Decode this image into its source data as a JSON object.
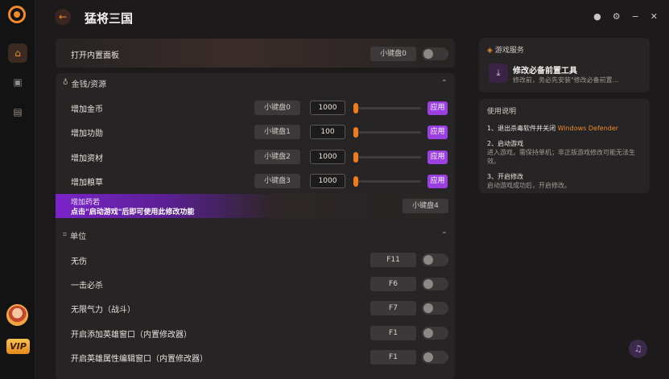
{
  "app": {
    "title": "猛将三国"
  },
  "rail": {
    "vip_label": "VIP"
  },
  "top_row": {
    "label": "打开内置面板",
    "key": "小键盘0"
  },
  "money": {
    "section_title": "金钱/资源",
    "rows": [
      {
        "label": "增加金币",
        "key": "小键盘0",
        "value": "1000",
        "apply": "应用"
      },
      {
        "label": "增加功勋",
        "key": "小键盘1",
        "value": "100",
        "apply": "应用"
      },
      {
        "label": "增加资材",
        "key": "小键盘2",
        "value": "1000",
        "apply": "应用"
      },
      {
        "label": "增加粮草",
        "key": "小键盘3",
        "value": "1000",
        "apply": "应用"
      }
    ],
    "banner": {
      "line1": "增加药若",
      "line2": "点击\"启动游戏\"后即可使用此修改功能",
      "key": "小键盘4"
    }
  },
  "unit": {
    "section_title": "单位",
    "rows": [
      {
        "label": "无伤",
        "key": "F11"
      },
      {
        "label": "一击必杀",
        "key": "F6"
      },
      {
        "label": "无限气力（战斗）",
        "key": "F7"
      },
      {
        "label": "开启添加英雄窗口（内置修改器）",
        "key": "F1"
      },
      {
        "label": "开启英雄属性编辑窗口（内置修改器）",
        "key": "F1"
      }
    ]
  },
  "service": {
    "heading": "游戏服务",
    "title": "修改必备前置工具",
    "desc": "修改前，务必先安装\"修改必备前置..."
  },
  "guide": {
    "heading": "使用说明",
    "step1_title": "1、退出杀毒软件并关闭",
    "step1_highlight": "Windows Defender",
    "step2_title": "2、启动游戏",
    "step2_body": "进入游戏，需保持单机；非正版游戏修改可能无法生效。",
    "step3_title": "3、开启修改",
    "step3_body": "启动游戏成功后，开启修改。"
  },
  "colors": {
    "accent": "#f08a2c",
    "purple": "#9a3fe0",
    "bg": "#1c1a1a",
    "panel": "#262424"
  }
}
